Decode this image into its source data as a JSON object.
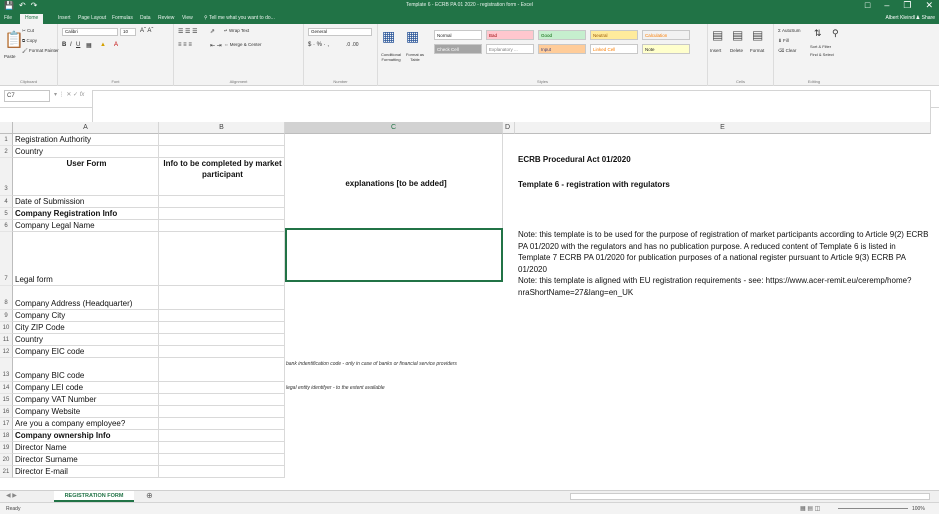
{
  "window": {
    "title": "Template 6 - ECRB PA 01 2020 - registration form - Excel",
    "user": "Albert Kleindl",
    "share": "Share"
  },
  "menu": {
    "tabs": [
      "File",
      "Home",
      "Insert",
      "Page Layout",
      "Formulas",
      "Data",
      "Review",
      "View"
    ],
    "tell_me": "Tell me what you want to do..."
  },
  "ribbon": {
    "clipboard": {
      "cut": "Cut",
      "copy": "Copy",
      "painter": "Format Painter",
      "paste": "Paste",
      "label": "Clipboard"
    },
    "font": {
      "name": "Calibri",
      "size": "10",
      "label": "Font"
    },
    "alignment": {
      "wrap": "Wrap Text",
      "merge": "Merge & Center",
      "label": "Alignment"
    },
    "number": {
      "format": "General",
      "label": "Number"
    },
    "styles": {
      "conditional": "Conditional Formatting",
      "format_table": "Format as Table",
      "items": [
        {
          "label": "Normal",
          "bg": "#ffffff",
          "color": "#222222"
        },
        {
          "label": "Bad",
          "bg": "#ffc7ce",
          "color": "#9c0006"
        },
        {
          "label": "Good",
          "bg": "#c6efce",
          "color": "#006100"
        },
        {
          "label": "Neutral",
          "bg": "#ffeb9c",
          "color": "#9c5700"
        },
        {
          "label": "Calculation",
          "bg": "#f2f2f2",
          "color": "#fa7d00"
        },
        {
          "label": "Check Cell",
          "bg": "#a5a5a5",
          "color": "#ffffff"
        },
        {
          "label": "Explanatory ...",
          "bg": "#ffffff",
          "color": "#7f7f7f"
        },
        {
          "label": "Input",
          "bg": "#ffcc99",
          "color": "#3f3f76"
        },
        {
          "label": "Linked Cell",
          "bg": "#ffffff",
          "color": "#fa7d00"
        },
        {
          "label": "Note",
          "bg": "#ffffcc",
          "color": "#222222"
        }
      ],
      "label": "Styles"
    },
    "cells": {
      "insert": "Insert",
      "delete": "Delete",
      "format": "Format",
      "label": "Cells"
    },
    "editing": {
      "autosum": "AutoSum",
      "fill": "Fill",
      "clear": "Clear",
      "sort": "Sort & Filter",
      "find": "Find & Select",
      "label": "Editing"
    }
  },
  "formula_bar": {
    "name_box": "C7",
    "fx": "fx",
    "content": ""
  },
  "columns": [
    "A",
    "B",
    "C",
    "D",
    "E"
  ],
  "rows": [
    {
      "n": "1",
      "a": "Registration Authority",
      "b": ""
    },
    {
      "n": "2",
      "a": "Country",
      "b": ""
    },
    {
      "n": "3",
      "a": "User Form",
      "b": "Info to be completed by market participant"
    },
    {
      "n": "4",
      "a": "Date of Submission",
      "b": ""
    },
    {
      "n": "5",
      "a": "Company Registration Info",
      "b": ""
    },
    {
      "n": "6",
      "a": "Company Legal Name",
      "b": ""
    },
    {
      "n": "7",
      "a": "Legal form",
      "b": ""
    },
    {
      "n": "8",
      "a": "Company Address (Headquarter)",
      "b": ""
    },
    {
      "n": "9",
      "a": "Company City",
      "b": ""
    },
    {
      "n": "10",
      "a": "City ZIP Code",
      "b": ""
    },
    {
      "n": "11",
      "a": "Country",
      "b": ""
    },
    {
      "n": "12",
      "a": "Company EIC code",
      "b": ""
    },
    {
      "n": "13",
      "a": "Company BIC code",
      "b": ""
    },
    {
      "n": "14",
      "a": "Company LEI code",
      "b": ""
    },
    {
      "n": "15",
      "a": "Company VAT Number",
      "b": ""
    },
    {
      "n": "16",
      "a": "Company Website",
      "b": ""
    },
    {
      "n": "17",
      "a": "Are you a company employee?",
      "b": ""
    },
    {
      "n": "18",
      "a": "Company ownership Info",
      "b": ""
    },
    {
      "n": "19",
      "a": "Director Name",
      "b": ""
    },
    {
      "n": "20",
      "a": "Director Surname",
      "b": ""
    },
    {
      "n": "21",
      "a": "Director E-mail",
      "b": ""
    }
  ],
  "cell_c3": "explanations [to be added]",
  "cell_c13": "bank indentification code - only in case of banks or financial service providers",
  "cell_c14": "legal entity identifyer - to the extent available",
  "cell_e2": "ECRB Procedural Act 01/2020",
  "cell_e3": "Template 6 - registration with regulators",
  "note1": "Note: this template is to be used for the purpose of registration of market participants according to Article 9(2) ECRB PA 01/2020 with the regulators and has no publication purpose. A reduced content of Template 6 is listed in Template 7 ECRB PA 01/2020 for publication purposes of a national register pursuant to Article 9(3) ECRB PA 01/2020",
  "note2": "Note: this template is aligned with EU registration requirements - see: https://www.acer-remit.eu/ceremp/home?nraShortName=27&lang=en_UK",
  "sheet_tab": "REGISTRATION FORM",
  "status": {
    "ready": "Ready",
    "zoom": "100%"
  }
}
